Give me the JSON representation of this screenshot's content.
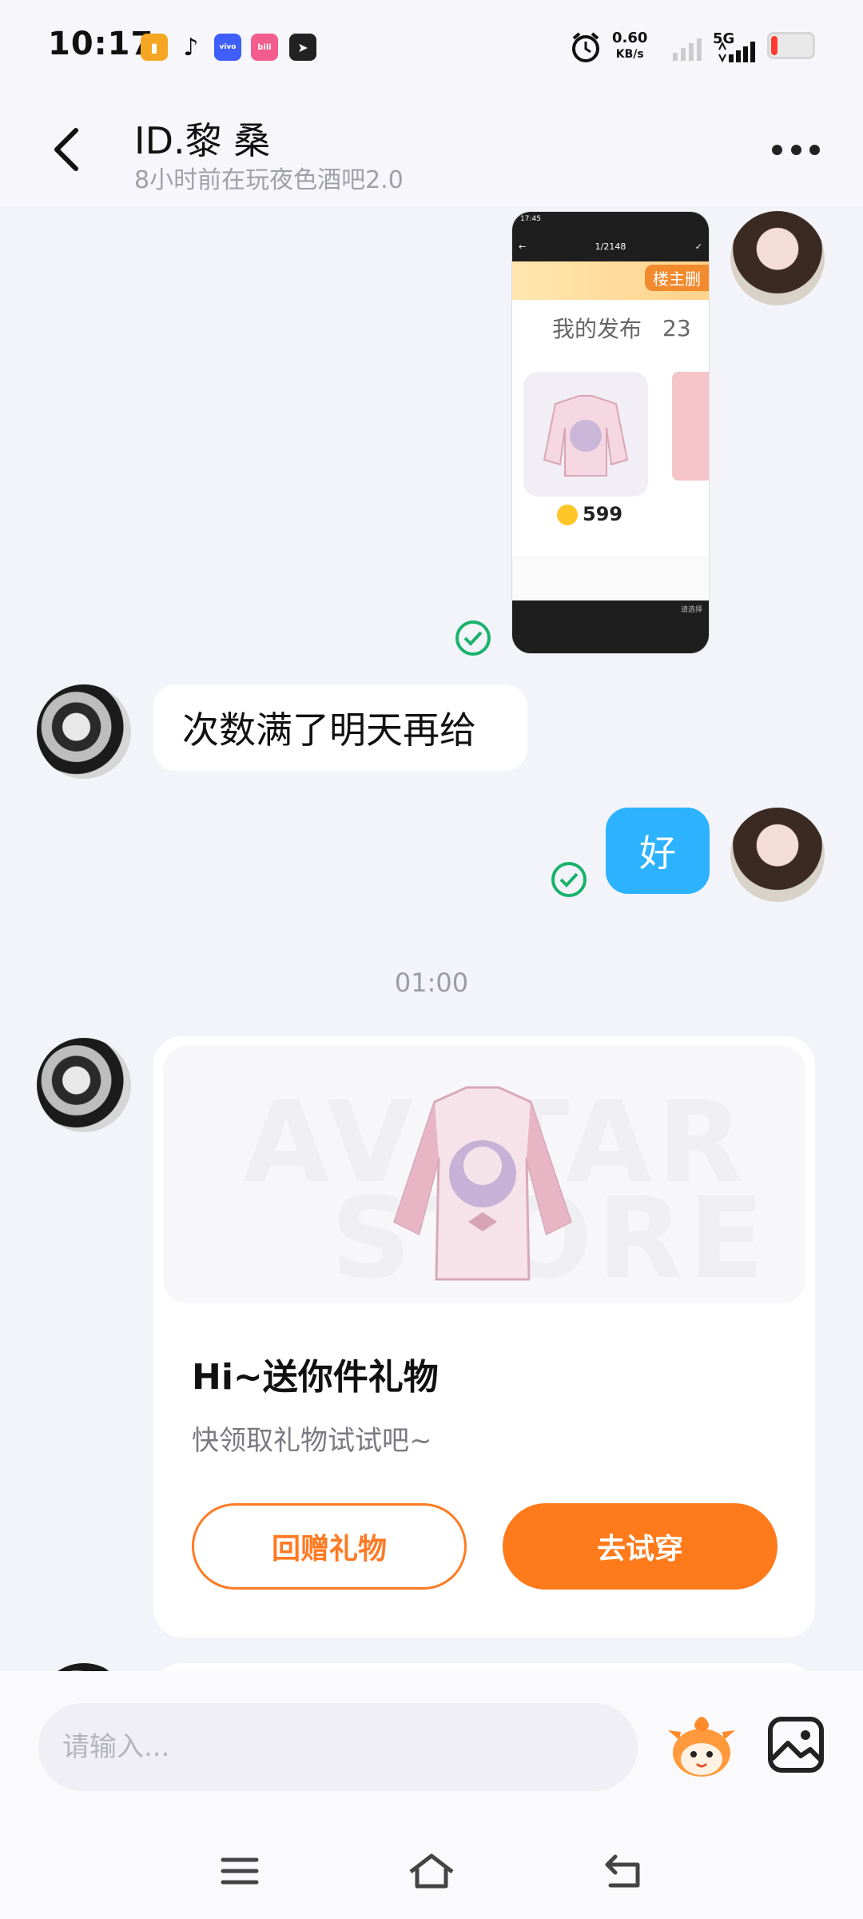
{
  "status_bar": {
    "time": "10:17",
    "net_speed_value": "0.60",
    "net_speed_unit": "KB/s",
    "network": "5G",
    "app_icons": [
      "sim-icon",
      "tiktok-icon",
      "vivo-icon",
      "bilibili-icon",
      "send-icon"
    ]
  },
  "header": {
    "title": "ID.黎 桑",
    "subtitle": "8小时前在玩夜色酒吧2.0"
  },
  "screenshot_msg": {
    "time": "17:45",
    "counter": "1/2148",
    "banner": "楼主删",
    "tab_label": "我的发布",
    "tab_count": "23",
    "price": "599",
    "footer_text": "请选择"
  },
  "messages": [
    {
      "side": "in",
      "text": "次数满了明天再给"
    },
    {
      "side": "out",
      "text": "好"
    }
  ],
  "time_divider": "01:00",
  "gift_card": {
    "watermark_line1": "AVATAR",
    "watermark_line2": "STORE",
    "title": "Hi~送你件礼物",
    "subtitle": "快领取礼物试试吧~",
    "regift_label": "回赠礼物",
    "tryon_label": "去试穿"
  },
  "input_bar": {
    "placeholder": "请输入..."
  },
  "colors": {
    "accent_orange": "#ff7a1a",
    "bubble_blue": "#2cb2ff",
    "read_green": "#19b36b",
    "background": "#f3f4fa"
  }
}
